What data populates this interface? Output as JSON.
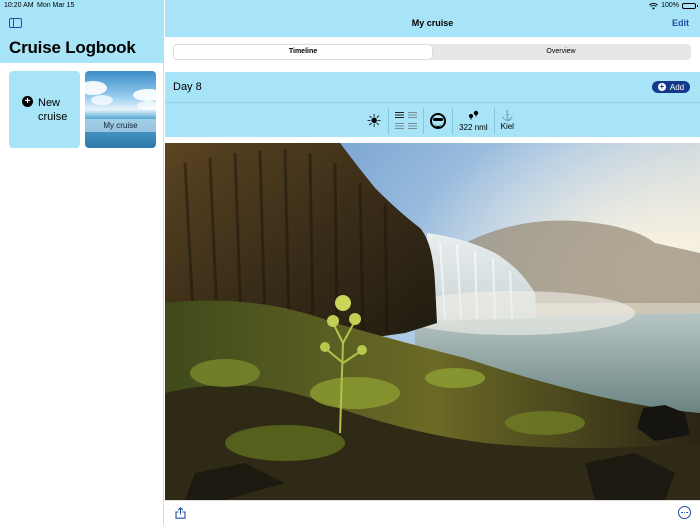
{
  "status_bar": {
    "time": "10:20 AM",
    "date": "Mon Mar 15",
    "battery": "100%"
  },
  "sidebar": {
    "title": "Cruise Logbook",
    "new_card_label": "New cruise",
    "cruise_cards": [
      {
        "label": "My cruise"
      }
    ]
  },
  "nav": {
    "title": "My cruise",
    "edit_label": "Edit"
  },
  "segments": {
    "timeline": "Timeline",
    "overview": "Overview",
    "selected": "Timeline"
  },
  "day": {
    "title": "Day 8",
    "add_label": "Add",
    "info": {
      "distance": "322 nml",
      "port": "Kiel"
    }
  },
  "icons": {
    "weather": "sun-icon",
    "sea_state": "waves-lines-icon",
    "mood": "sunglasses-face-icon",
    "distance": "route-pins-icon",
    "port": "anchor-icon",
    "share": "share-icon",
    "more": "more-ellipsis-icon",
    "sidebar": "sidebar-toggle-icon"
  },
  "colors": {
    "accent_bg": "#a7e4f7",
    "tint": "#1d4fa0",
    "button": "#14388a"
  }
}
